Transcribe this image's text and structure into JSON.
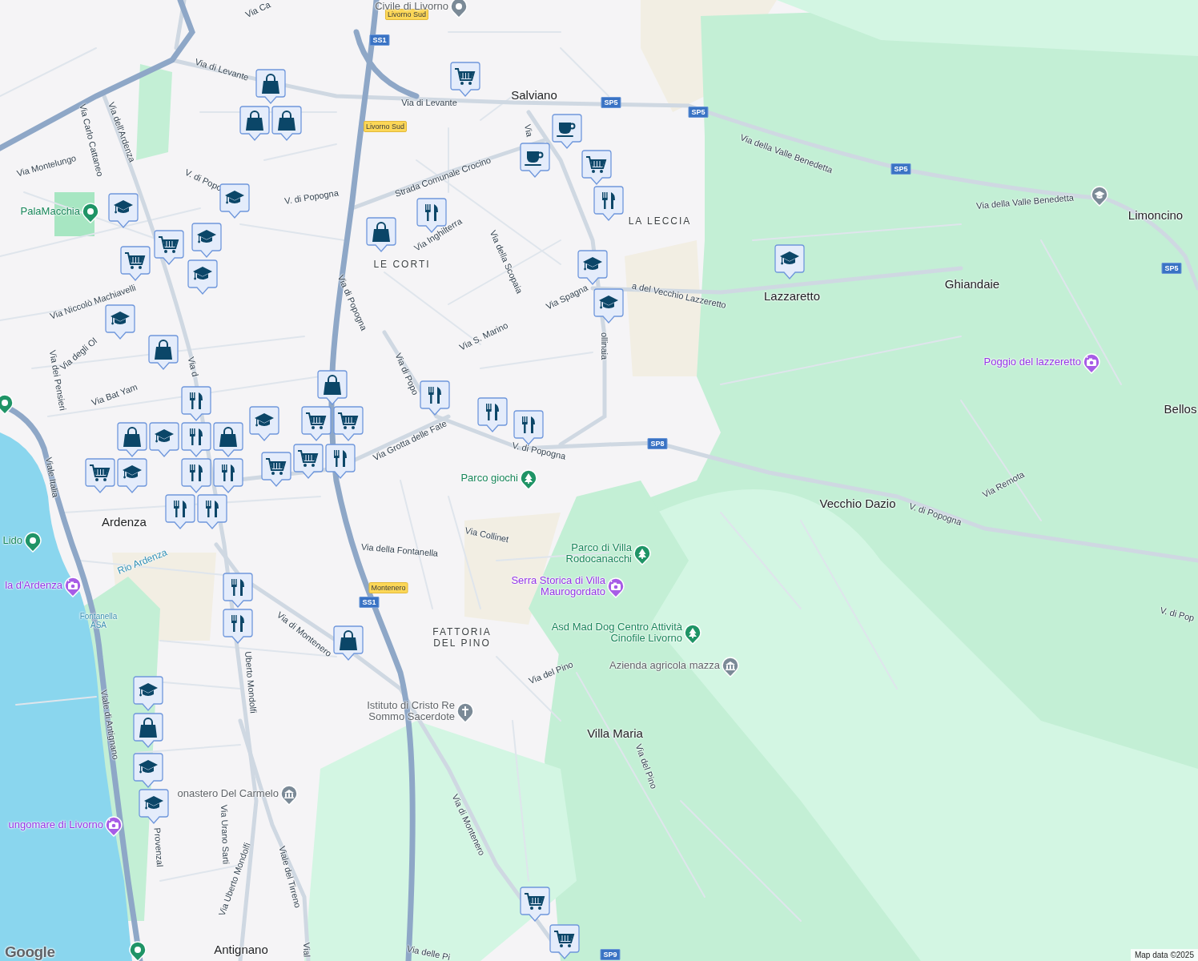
{
  "map": {
    "place_labels": [
      {
        "text": "Salviano",
        "kind": "town"
      },
      {
        "text": "LA LECCIA",
        "kind": "district"
      },
      {
        "text": "LE CORTI",
        "kind": "district"
      },
      {
        "text": "Lazzaretto",
        "kind": "town"
      },
      {
        "text": "Ghiandaie",
        "kind": "town"
      },
      {
        "text": "Limoncino",
        "kind": "town"
      },
      {
        "text": "Bellos",
        "kind": "town"
      },
      {
        "text": "Vecchio Dazio",
        "kind": "town"
      },
      {
        "text": "Villa Maria",
        "kind": "town"
      },
      {
        "text": "FATTORIA DEL PINO",
        "kind": "district"
      },
      {
        "text": "Antignano",
        "kind": "town"
      },
      {
        "text": "Ardenza",
        "kind": "town"
      }
    ],
    "street_labels": [
      "Via Ca",
      "Via di Levante",
      "Via di Levante",
      "Via dell'Ardenza",
      "Via Carlo Cattaneo",
      "Via Montelungo",
      "V. di Popo",
      "V. di Popogna",
      "Strada Comunale Crocino",
      "Via Inghilterra",
      "Via della Scopaia",
      "Via di Popogna",
      "Via Spagna",
      "a del Vecchio Lazzeretto",
      "ollinaia",
      "Via S. Marino",
      "Via Niccolò Machiavelli",
      "Via degli Ol",
      "Via dei Pensieri",
      "Via Bat Yam",
      "Via d",
      "Via di Popo",
      "Via Grotta delle Fate",
      "V. di Popogna",
      "Viale Italia",
      "Via Collinet",
      "Via della Fontanella",
      "Via di Montenero",
      "Uberto Mondolfi",
      "Via del Pino",
      "Viale di Antignano",
      "Via del Pino",
      "Provenzal",
      "Via Urano Sarti",
      "Via Uberto Mondolfi",
      "Viale del Tirreno",
      "Via di Montenero",
      "Vial",
      "Via delle Pi",
      "Via della Valle Benedetta",
      "Via della Valle Benedetta",
      "Via Remota",
      "V. di Popogna",
      "V. di Pop",
      "Via"
    ],
    "other_labels": [
      {
        "text": "Rio Ardenza",
        "kind": "water"
      },
      {
        "text": "Fontanella ASA",
        "kind": "facility"
      }
    ],
    "road_signs": [
      {
        "text": "Livorno Sud",
        "kind": "exit"
      },
      {
        "text": "SS1",
        "kind": "route"
      },
      {
        "text": "Livorno Sud",
        "kind": "exit"
      },
      {
        "text": "SP5",
        "kind": "route"
      },
      {
        "text": "SP5",
        "kind": "route"
      },
      {
        "text": "SP5",
        "kind": "route"
      },
      {
        "text": "SP5",
        "kind": "route"
      },
      {
        "text": "SP8",
        "kind": "route"
      },
      {
        "text": "Montenero",
        "kind": "exit"
      },
      {
        "text": "SS1",
        "kind": "route"
      },
      {
        "text": "SP9",
        "kind": "route"
      }
    ],
    "places_of_interest": [
      {
        "text": "PalaMacchia",
        "kind": "sports"
      },
      {
        "text": "Lido",
        "kind": "beach"
      },
      {
        "text": "la d'Ardenza",
        "kind": "attraction"
      },
      {
        "text": "Parco giochi",
        "kind": "park"
      },
      {
        "text": "Parco di Villa Rodocanacchi",
        "kind": "park"
      },
      {
        "text": "Serra Storica di Villa Maurogordato",
        "kind": "attraction"
      },
      {
        "text": "Asd Mad Dog Centro Attività Cinofile Livorno",
        "kind": "park"
      },
      {
        "text": "Azienda agricola mazza",
        "kind": "farm"
      },
      {
        "text": "Istituto di Cristo Re Sommo Sacerdote",
        "kind": "church"
      },
      {
        "text": "onastero Del Carmelo",
        "kind": "museum"
      },
      {
        "text": "ungomare di Livorno",
        "kind": "attraction"
      },
      {
        "text": "Poggio del lazzeretto",
        "kind": "attraction"
      },
      {
        "kind": "school"
      },
      {
        "kind": "beach"
      },
      {
        "kind": "beach"
      },
      {
        "text": "Civile di Livorno",
        "kind": "landmark"
      }
    ],
    "markers": [
      {
        "kind": "grocery"
      },
      {
        "kind": "shop"
      },
      {
        "kind": "shop"
      },
      {
        "kind": "shop"
      },
      {
        "kind": "school"
      },
      {
        "kind": "school"
      },
      {
        "kind": "grocery"
      },
      {
        "kind": "school"
      },
      {
        "kind": "grocery"
      },
      {
        "kind": "school"
      },
      {
        "kind": "shop"
      },
      {
        "kind": "restaurant"
      },
      {
        "kind": "cafe"
      },
      {
        "kind": "cafe"
      },
      {
        "kind": "grocery"
      },
      {
        "kind": "restaurant"
      },
      {
        "kind": "school"
      },
      {
        "kind": "school"
      },
      {
        "kind": "school"
      },
      {
        "kind": "school"
      },
      {
        "kind": "shop"
      },
      {
        "kind": "restaurant"
      },
      {
        "kind": "shop"
      },
      {
        "kind": "grocery"
      },
      {
        "kind": "grocery"
      },
      {
        "kind": "shop"
      },
      {
        "kind": "restaurant"
      },
      {
        "kind": "shop"
      },
      {
        "kind": "restaurant"
      },
      {
        "kind": "school"
      },
      {
        "kind": "grocery"
      },
      {
        "kind": "school"
      },
      {
        "kind": "school"
      },
      {
        "kind": "grocery"
      },
      {
        "kind": "grocery"
      },
      {
        "kind": "restaurant"
      },
      {
        "kind": "restaurant"
      },
      {
        "kind": "restaurant"
      },
      {
        "kind": "restaurant"
      },
      {
        "kind": "restaurant"
      },
      {
        "kind": "restaurant"
      },
      {
        "kind": "restaurant"
      },
      {
        "kind": "restaurant"
      },
      {
        "kind": "restaurant"
      },
      {
        "kind": "shop"
      },
      {
        "kind": "school"
      },
      {
        "kind": "shop"
      },
      {
        "kind": "school"
      },
      {
        "kind": "school"
      },
      {
        "kind": "grocery"
      },
      {
        "kind": "grocery"
      }
    ]
  },
  "attribution": {
    "logo": "Google",
    "text": "Map data ©2025"
  }
}
